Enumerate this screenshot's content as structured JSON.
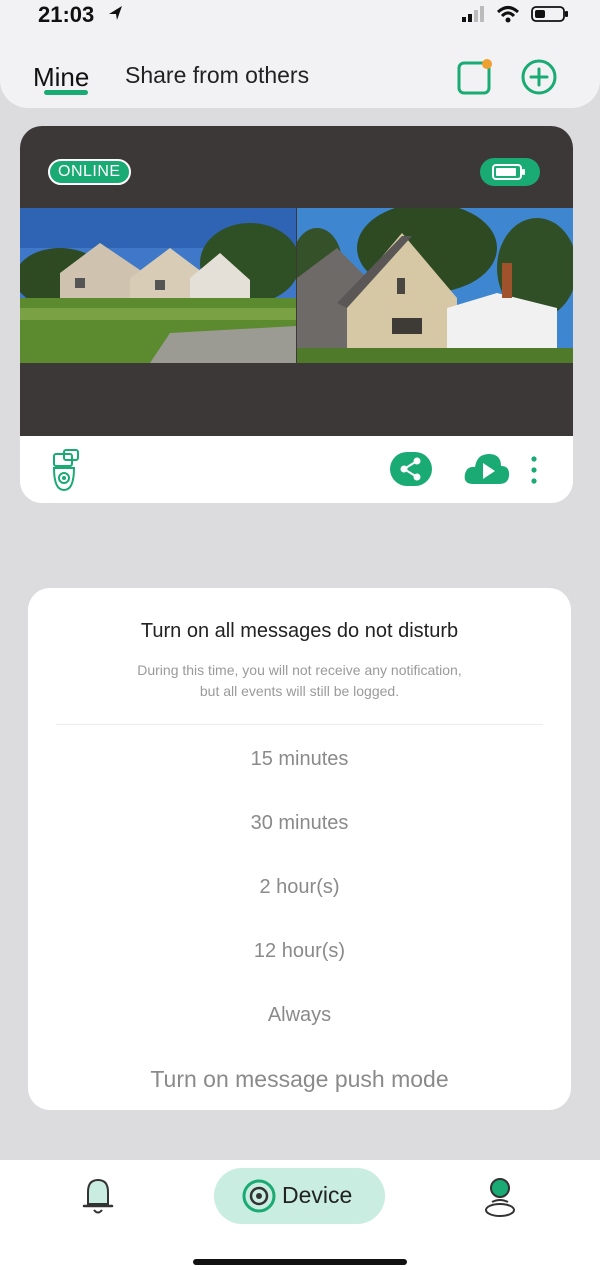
{
  "status": {
    "time": "21:03"
  },
  "header": {
    "tabs": [
      {
        "label": "Mine"
      },
      {
        "label": "Share from others"
      }
    ]
  },
  "device_card": {
    "status_badge": "ONLINE",
    "battery_icon": "battery-icon",
    "share_icon": "share-icon",
    "cloud_icon": "cloud-play-icon",
    "more_icon": "more-vertical-icon"
  },
  "dnd_sheet": {
    "title": "Turn on all messages do not disturb",
    "description_line1": "During this time, you will not receive any notification,",
    "description_line2": "but all events will still be logged.",
    "options": [
      "15 minutes",
      "30 minutes",
      "2 hour(s)",
      "12 hour(s)",
      "Always"
    ],
    "push_mode": "Turn on message push mode"
  },
  "bottom_nav": {
    "device_label": "Device"
  },
  "colors": {
    "accent": "#1aaa74",
    "accent_light": "#c9ede0",
    "card_dark": "#3d3838",
    "background": "#dcdcdf"
  }
}
